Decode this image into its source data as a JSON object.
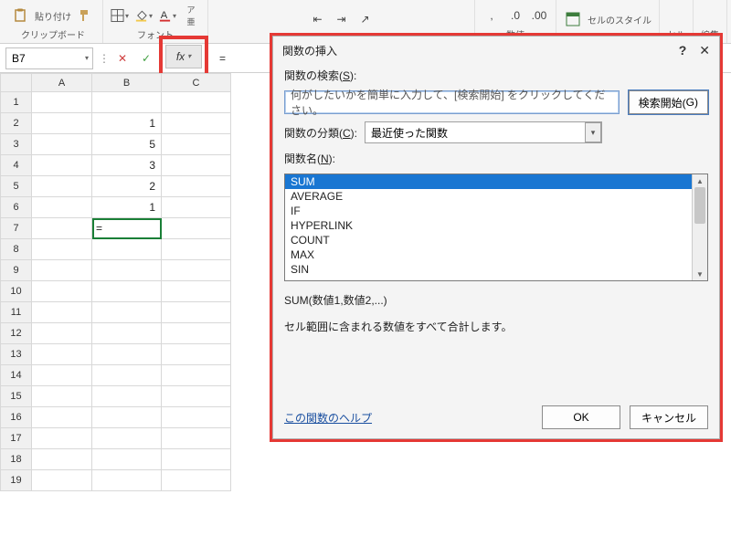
{
  "ribbon": {
    "paste_label": "貼り付け",
    "clipboard_label": "クリップボード",
    "font_label": "フォント",
    "number_label": "数値",
    "cellstyle_label": "セルのスタイル",
    "cells_label": "セル",
    "edit_label": "編集"
  },
  "fbar": {
    "namebox": "B7",
    "formula_text": "="
  },
  "sheet": {
    "columns": [
      "A",
      "B",
      "C"
    ],
    "rows": [
      {
        "n": 1,
        "A": "",
        "B": "",
        "C": ""
      },
      {
        "n": 2,
        "A": "",
        "B": "1",
        "C": ""
      },
      {
        "n": 3,
        "A": "",
        "B": "5",
        "C": ""
      },
      {
        "n": 4,
        "A": "",
        "B": "3",
        "C": ""
      },
      {
        "n": 5,
        "A": "",
        "B": "2",
        "C": ""
      },
      {
        "n": 6,
        "A": "",
        "B": "1",
        "C": ""
      },
      {
        "n": 7,
        "A": "",
        "B": "=",
        "C": ""
      },
      {
        "n": 8,
        "A": "",
        "B": "",
        "C": ""
      },
      {
        "n": 9,
        "A": "",
        "B": "",
        "C": ""
      },
      {
        "n": 10,
        "A": "",
        "B": "",
        "C": ""
      },
      {
        "n": 11,
        "A": "",
        "B": "",
        "C": ""
      },
      {
        "n": 12,
        "A": "",
        "B": "",
        "C": ""
      },
      {
        "n": 13,
        "A": "",
        "B": "",
        "C": ""
      },
      {
        "n": 14,
        "A": "",
        "B": "",
        "C": ""
      },
      {
        "n": 15,
        "A": "",
        "B": "",
        "C": ""
      },
      {
        "n": 16,
        "A": "",
        "B": "",
        "C": ""
      },
      {
        "n": 17,
        "A": "",
        "B": "",
        "C": ""
      },
      {
        "n": 18,
        "A": "",
        "B": "",
        "C": ""
      },
      {
        "n": 19,
        "A": "",
        "B": "",
        "C": ""
      }
    ],
    "selected_row": 7,
    "selected_col": "B"
  },
  "dialog": {
    "title": "関数の挿入",
    "help_glyph": "?",
    "close_glyph": "✕",
    "search_label_pre": "関数の検索(",
    "search_label_ul": "S",
    "search_label_post": "):",
    "search_placeholder": "何がしたいかを簡単に入力して、[検索開始] をクリックしてください。",
    "search_btn_pre": "検索開始(",
    "search_btn_ul": "G",
    "search_btn_post": ")",
    "category_label_pre": "関数の分類(",
    "category_label_ul": "C",
    "category_label_post": "):",
    "category_value": "最近使った関数",
    "name_label_pre": "関数名(",
    "name_label_ul": "N",
    "name_label_post": "):",
    "functions": [
      "SUM",
      "AVERAGE",
      "IF",
      "HYPERLINK",
      "COUNT",
      "MAX",
      "SIN"
    ],
    "selected_function": "SUM",
    "syntax": "SUM(数値1,数値2,...)",
    "description": "セル範囲に含まれる数値をすべて合計します。",
    "help_link": "この関数のヘルプ",
    "ok_label": "OK",
    "cancel_label": "キャンセル"
  }
}
